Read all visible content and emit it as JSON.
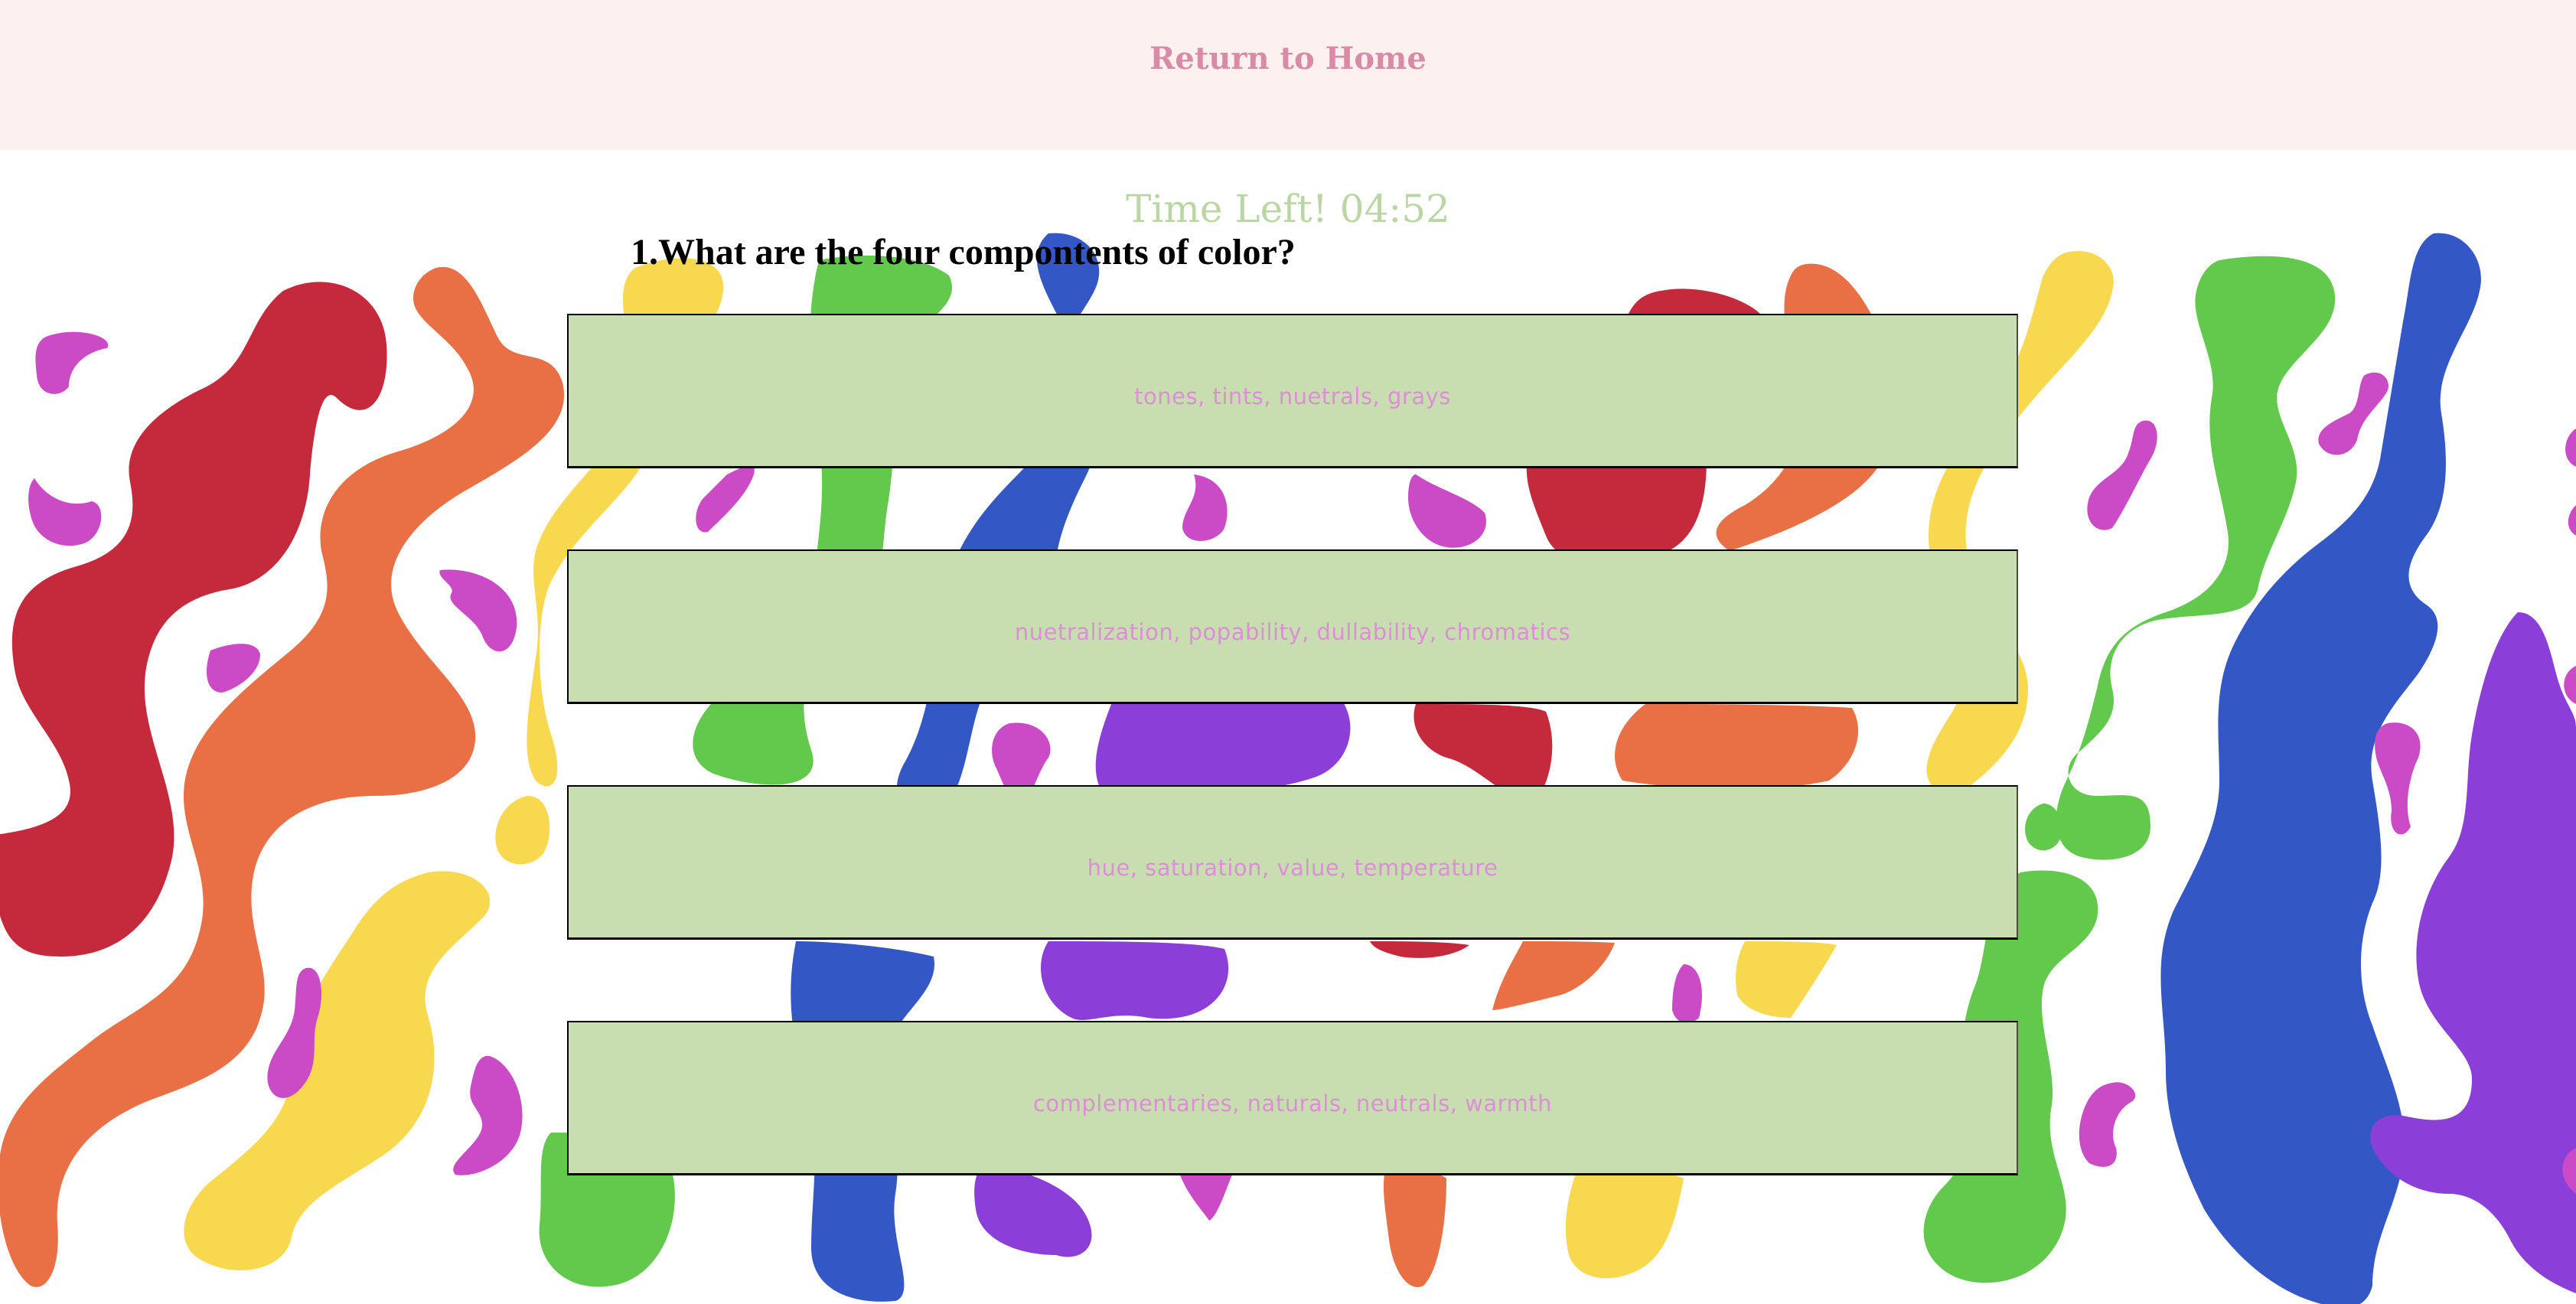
{
  "header": {
    "home_link": "Return to Home"
  },
  "timer": {
    "text": "Time Left! 04:52"
  },
  "quiz": {
    "question": "1.What are the four compontents of color?",
    "answers": [
      {
        "label": "tones, tints, nuetrals, grays"
      },
      {
        "label": "nuetralization, popability, dullability, chromatics"
      },
      {
        "label": "hue, saturation, value, temperature"
      },
      {
        "label": "complementaries, naturals, neutrals, warmth"
      }
    ]
  },
  "colors": {
    "header_bg": "#fcf1ef",
    "home_link": "#d98aa6",
    "timer": "#b9d6a4",
    "answer_bg": "#c8ddb0",
    "answer_text": "#dc8fd7",
    "blob_red": "#c52a3c",
    "blob_orange": "#e96f44",
    "blob_yellow": "#f8d84f",
    "blob_green": "#62c94d",
    "blob_blue": "#3457c6",
    "blob_purple": "#8b3fd8",
    "blob_magenta": "#cb4bc6"
  }
}
